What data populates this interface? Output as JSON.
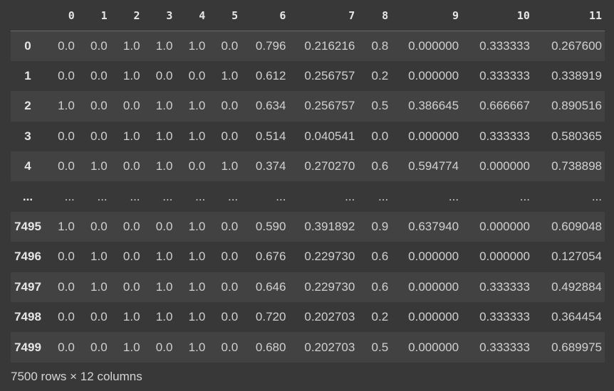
{
  "table": {
    "columns": [
      "0",
      "1",
      "2",
      "3",
      "4",
      "5",
      "6",
      "7",
      "8",
      "9",
      "10",
      "11"
    ],
    "rows": [
      {
        "index": "0",
        "cells": [
          "0.0",
          "0.0",
          "1.0",
          "1.0",
          "1.0",
          "0.0",
          "0.796",
          "0.216216",
          "0.8",
          "0.000000",
          "0.333333",
          "0.267600"
        ]
      },
      {
        "index": "1",
        "cells": [
          "0.0",
          "0.0",
          "1.0",
          "0.0",
          "0.0",
          "1.0",
          "0.612",
          "0.256757",
          "0.2",
          "0.000000",
          "0.333333",
          "0.338919"
        ]
      },
      {
        "index": "2",
        "cells": [
          "1.0",
          "0.0",
          "0.0",
          "1.0",
          "1.0",
          "0.0",
          "0.634",
          "0.256757",
          "0.5",
          "0.386645",
          "0.666667",
          "0.890516"
        ]
      },
      {
        "index": "3",
        "cells": [
          "0.0",
          "0.0",
          "1.0",
          "1.0",
          "1.0",
          "0.0",
          "0.514",
          "0.040541",
          "0.0",
          "0.000000",
          "0.333333",
          "0.580365"
        ]
      },
      {
        "index": "4",
        "cells": [
          "0.0",
          "1.0",
          "0.0",
          "1.0",
          "0.0",
          "1.0",
          "0.374",
          "0.270270",
          "0.6",
          "0.594774",
          "0.000000",
          "0.738898"
        ]
      },
      {
        "index": "...",
        "cells": [
          "...",
          "...",
          "...",
          "...",
          "...",
          "...",
          "...",
          "...",
          "...",
          "...",
          "...",
          "..."
        ]
      },
      {
        "index": "7495",
        "cells": [
          "1.0",
          "0.0",
          "0.0",
          "0.0",
          "1.0",
          "0.0",
          "0.590",
          "0.391892",
          "0.9",
          "0.637940",
          "0.000000",
          "0.609048"
        ]
      },
      {
        "index": "7496",
        "cells": [
          "0.0",
          "1.0",
          "0.0",
          "1.0",
          "1.0",
          "0.0",
          "0.676",
          "0.229730",
          "0.6",
          "0.000000",
          "0.000000",
          "0.127054"
        ]
      },
      {
        "index": "7497",
        "cells": [
          "0.0",
          "1.0",
          "0.0",
          "1.0",
          "1.0",
          "0.0",
          "0.646",
          "0.229730",
          "0.6",
          "0.000000",
          "0.333333",
          "0.492884"
        ]
      },
      {
        "index": "7498",
        "cells": [
          "0.0",
          "0.0",
          "1.0",
          "1.0",
          "1.0",
          "0.0",
          "0.720",
          "0.202703",
          "0.2",
          "0.000000",
          "0.333333",
          "0.364454"
        ]
      },
      {
        "index": "7499",
        "cells": [
          "0.0",
          "0.0",
          "1.0",
          "0.0",
          "1.0",
          "0.0",
          "0.680",
          "0.202703",
          "0.5",
          "0.000000",
          "0.333333",
          "0.689975"
        ]
      }
    ]
  },
  "footer": {
    "shape_text": "7500 rows × 12 columns"
  },
  "colors": {
    "background": "#383838",
    "row_stripe": "#424242",
    "text": "#d0d0d0"
  }
}
